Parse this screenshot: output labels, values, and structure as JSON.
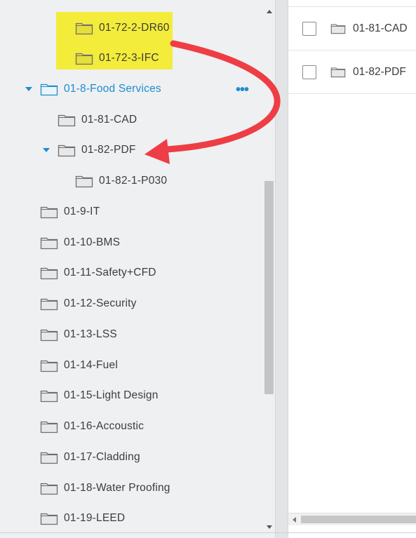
{
  "tree": {
    "items": [
      {
        "label": "01-72-2-DR60",
        "indent": 2,
        "caret": false,
        "active": false,
        "highlighted": true
      },
      {
        "label": "01-72-3-IFC",
        "indent": 2,
        "caret": false,
        "active": false,
        "highlighted": true
      },
      {
        "label": "01-8-Food Services",
        "indent": 0,
        "caret": true,
        "active": true,
        "highlighted": false
      },
      {
        "label": "01-81-CAD",
        "indent": 1,
        "caret": false,
        "active": false,
        "highlighted": false
      },
      {
        "label": "01-82-PDF",
        "indent": 1,
        "caret": true,
        "active": false,
        "highlighted": false
      },
      {
        "label": "01-82-1-P030",
        "indent": 2,
        "caret": false,
        "active": false,
        "highlighted": false
      },
      {
        "label": "01-9-IT",
        "indent": 0,
        "caret": false,
        "active": false,
        "highlighted": false
      },
      {
        "label": "01-10-BMS",
        "indent": 0,
        "caret": false,
        "active": false,
        "highlighted": false
      },
      {
        "label": "01-11-Safety+CFD",
        "indent": 0,
        "caret": false,
        "active": false,
        "highlighted": false
      },
      {
        "label": "01-12-Security",
        "indent": 0,
        "caret": false,
        "active": false,
        "highlighted": false
      },
      {
        "label": "01-13-LSS",
        "indent": 0,
        "caret": false,
        "active": false,
        "highlighted": false
      },
      {
        "label": "01-14-Fuel",
        "indent": 0,
        "caret": false,
        "active": false,
        "highlighted": false
      },
      {
        "label": "01-15-Light Design",
        "indent": 0,
        "caret": false,
        "active": false,
        "highlighted": false
      },
      {
        "label": "01-16-Accoustic",
        "indent": 0,
        "caret": false,
        "active": false,
        "highlighted": false
      },
      {
        "label": "01-17-Cladding",
        "indent": 0,
        "caret": false,
        "active": false,
        "highlighted": false
      },
      {
        "label": "01-18-Water Proofing",
        "indent": 0,
        "caret": false,
        "active": false,
        "highlighted": false
      },
      {
        "label": "01-19-LEED",
        "indent": 0,
        "caret": false,
        "active": false,
        "highlighted": false
      }
    ],
    "more_menu": "•••"
  },
  "content": {
    "rows": [
      {
        "label": "01-81-CAD"
      },
      {
        "label": "01-82-PDF"
      }
    ]
  },
  "colors": {
    "accent": "#1f8ccf",
    "highlight": "#f4ec3a",
    "arrow": "#ee3d45",
    "folder_fill": "#e6e8ea",
    "folder_stroke": "#6e6e6e",
    "tree_bg": "#eef0f2"
  },
  "icons": {
    "folder": "folder-icon",
    "caret": "caret-down-icon",
    "more": "more-horizontal-icon",
    "arrow": "annotation-arrow"
  }
}
